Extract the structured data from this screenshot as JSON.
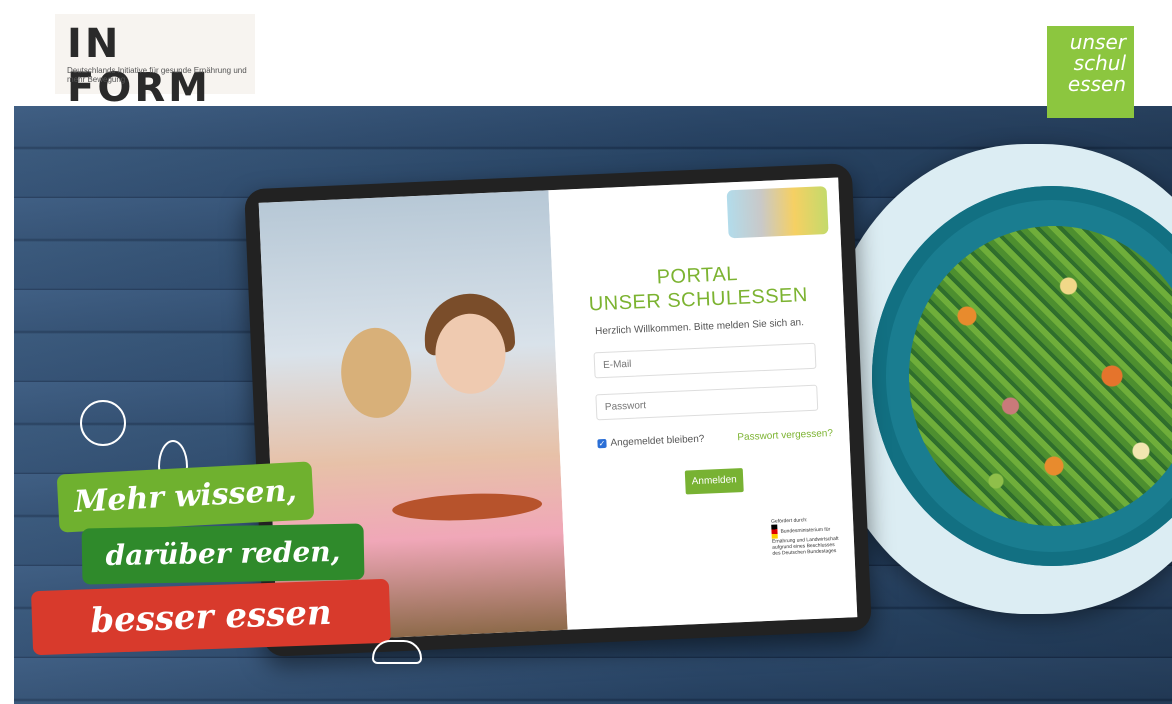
{
  "header": {
    "inform_logo": {
      "word": "IN FORM",
      "tagline": "Deutschlands Initiative für gesunde Ernährung und mehr Bewegung"
    },
    "brand_logo": {
      "line1": "unser",
      "line2": "schul",
      "line3": "essen"
    }
  },
  "login": {
    "title_line1": "PORTAL",
    "title_line2": "UNSER SCHULESSEN",
    "welcome": "Herzlich Willkommen. Bitte melden Sie sich an.",
    "email_placeholder": "E-Mail",
    "password_placeholder": "Passwort",
    "remember_label": "Angemeldet bleiben?",
    "remember_checked": true,
    "forgot_link": "Passwort vergessen?",
    "submit_label": "Anmelden",
    "funder_intro": "Gefördert durch:",
    "funder_name": "Bundesministerium für Ernährung und Landwirtschaft",
    "funder_note": "aufgrund eines Beschlusses des Deutschen Bundestages"
  },
  "slogan": {
    "line1": "Mehr wissen,",
    "line2": "darüber reden,",
    "line3": "besser essen"
  },
  "colors": {
    "brand_green": "#8cc63f",
    "button_green": "#78b233",
    "slogan_red": "#d83a2c"
  }
}
